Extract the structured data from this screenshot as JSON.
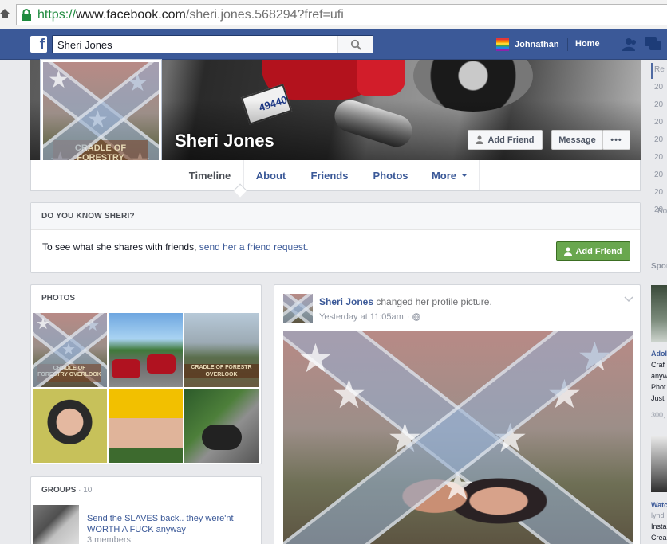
{
  "browser": {
    "url_protocol": "https://",
    "url_domain": "www.facebook.com",
    "url_path": "/sheri.jones.568294?fref=ufi"
  },
  "topbar": {
    "search_value": "Sheri Jones",
    "user_name": "Johnathan",
    "home_label": "Home"
  },
  "profile": {
    "name": "Sheri Jones",
    "add_friend_label": "Add Friend",
    "message_label": "Message",
    "more_label": "•••",
    "pic_sign_text": "CRADLE OF FORESTRY OVERLOOK"
  },
  "nav": {
    "tabs": [
      {
        "label": "Timeline"
      },
      {
        "label": "About"
      },
      {
        "label": "Friends"
      },
      {
        "label": "Photos"
      },
      {
        "label": "More"
      }
    ]
  },
  "know_box": {
    "title": "DO YOU KNOW SHERI?",
    "message": "To see what she shares with friends,",
    "link": "send her a friend request.",
    "button": "Add Friend"
  },
  "photos_box": {
    "title": "PHOTOS",
    "sign_text": "CRADLE OF FORESTRY OVERLOOK"
  },
  "groups_box": {
    "title": "GROUPS",
    "separator": " · ",
    "count": "10",
    "group_name": "Send the SLAVES back.. they were'nt WORTH A FUCK anyway",
    "members": "3 members"
  },
  "post": {
    "author": "Sheri Jones",
    "action": "changed her profile picture.",
    "time": "Yesterday at 11:05am",
    "dot": "·"
  },
  "right_ticker": {
    "years": [
      "Re",
      "20",
      "20",
      "20",
      "20",
      "20",
      "20",
      "20",
      "20",
      "Bo"
    ],
    "sponsored": "Spor",
    "ad1_lines": [
      "Adol",
      "Craf",
      "anyw",
      "Phot",
      "Just",
      "300,"
    ],
    "ad2_lines": [
      "Watc",
      "lynd",
      "Insta",
      "Crea"
    ]
  },
  "colors": {
    "facebook_blue": "#3b5998",
    "link_blue": "#3b5998",
    "green_button": "#69a74e",
    "page_bg": "#e9eaed"
  }
}
